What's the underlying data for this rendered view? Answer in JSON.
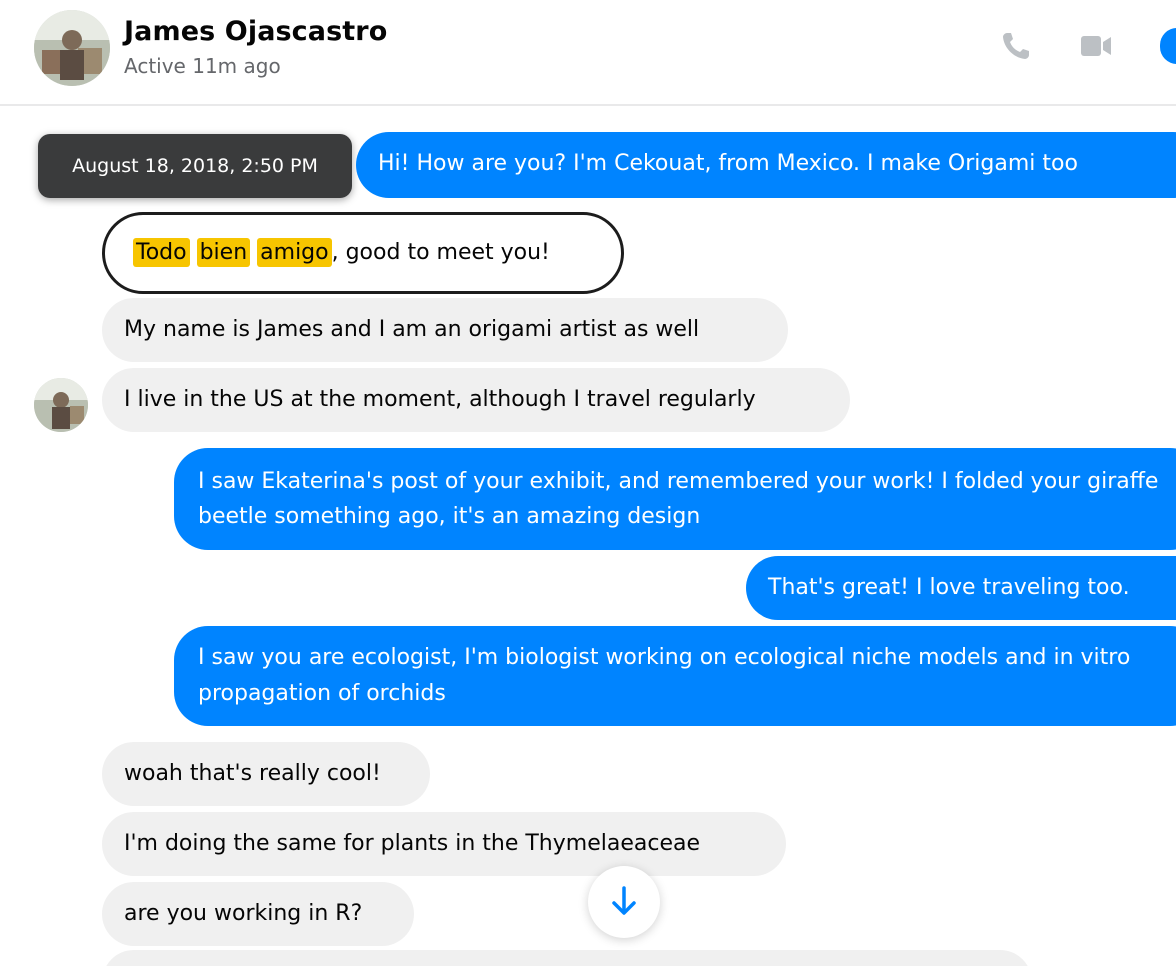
{
  "header": {
    "contact_name": "James Ojascastro",
    "status": "Active 11m ago",
    "icons": [
      "avatar",
      "phone-icon",
      "video-camera-icon",
      "info-icon"
    ]
  },
  "tooltip": {
    "timestamp": "August 18, 2018, 2:50 PM"
  },
  "messages": [
    {
      "side": "out",
      "text": "Hi! How are you? I'm Cekouat, from Mexico. I make Origami too"
    },
    {
      "side": "in",
      "highlighted_words": [
        "Todo",
        "bien",
        "amigo"
      ],
      "rest": ", good to meet you!"
    },
    {
      "side": "in",
      "text": "My name is James and I am an origami artist as well"
    },
    {
      "side": "in",
      "text": "I live in the US at the moment, although I travel regularly"
    },
    {
      "side": "out",
      "text": "I saw Ekaterina's post of your exhibit, and remembered your work! I folded your giraffe beetle something ago, it's an amazing design"
    },
    {
      "side": "out",
      "text": "That's great! I love traveling too."
    },
    {
      "side": "out",
      "text": "I saw you are ecologist, I'm biologist working on ecological niche models and in vitro propagation of orchids"
    },
    {
      "side": "in",
      "text": "woah that's really cool!"
    },
    {
      "side": "in",
      "text": "I'm doing the same for plants in the Thymelaeaceae"
    },
    {
      "side": "in",
      "text": "are you working in R?"
    }
  ],
  "colors": {
    "outgoing_bubble": "#0084ff",
    "incoming_bubble": "#f0f0f0",
    "highlight": "#f7c500",
    "tooltip_bg": "#3a3b3c"
  }
}
